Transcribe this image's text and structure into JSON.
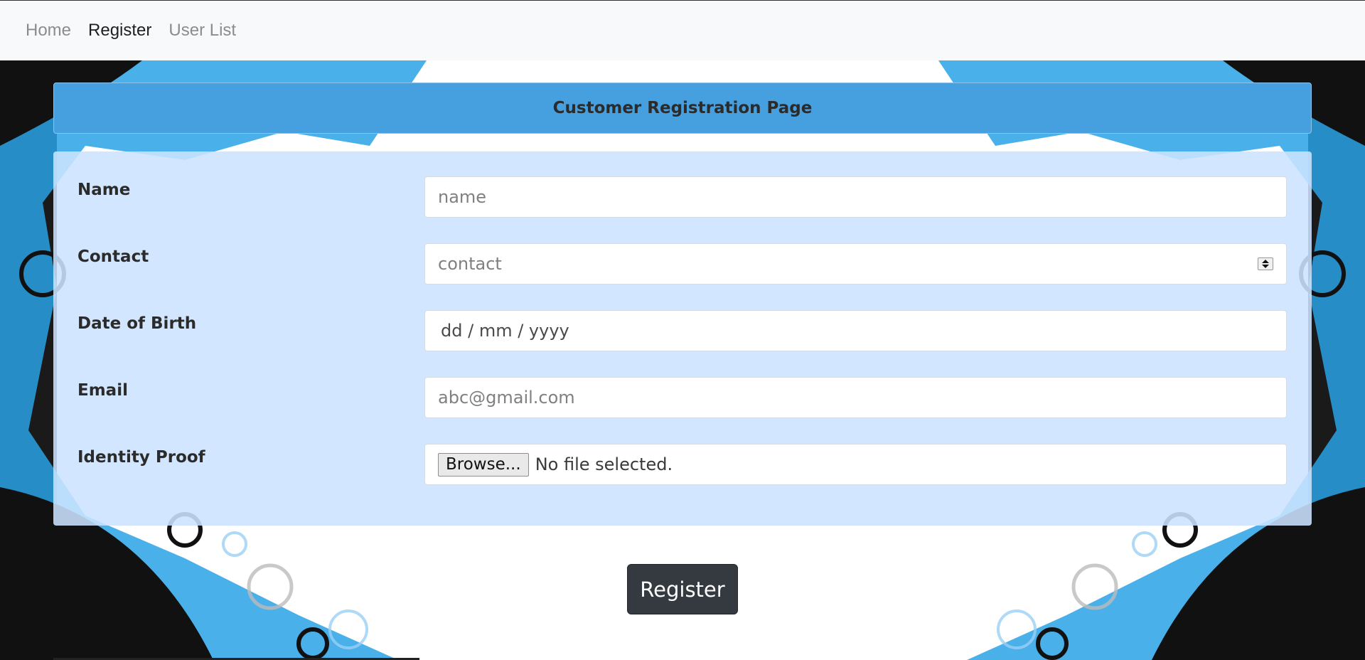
{
  "nav": {
    "items": [
      {
        "label": "Home",
        "active": false
      },
      {
        "label": "Register",
        "active": true
      },
      {
        "label": "User List",
        "active": false
      }
    ]
  },
  "header": {
    "title": "Customer Registration Page"
  },
  "form": {
    "name": {
      "label": "Name",
      "placeholder": "name"
    },
    "contact": {
      "label": "Contact",
      "placeholder": "contact"
    },
    "dob": {
      "label": "Date of Birth",
      "value": "dd / mm / yyyy"
    },
    "email": {
      "label": "Email",
      "placeholder": "abc@gmail.com"
    },
    "identity": {
      "label": "Identity Proof",
      "browse_label": "Browse...",
      "status": "No file selected."
    }
  },
  "actions": {
    "register_label": "Register"
  },
  "colors": {
    "header_bg": "#46a0e0",
    "form_bg": "#cce4ff",
    "button_bg": "#343a40",
    "background_accent": "#2aa2e6"
  }
}
